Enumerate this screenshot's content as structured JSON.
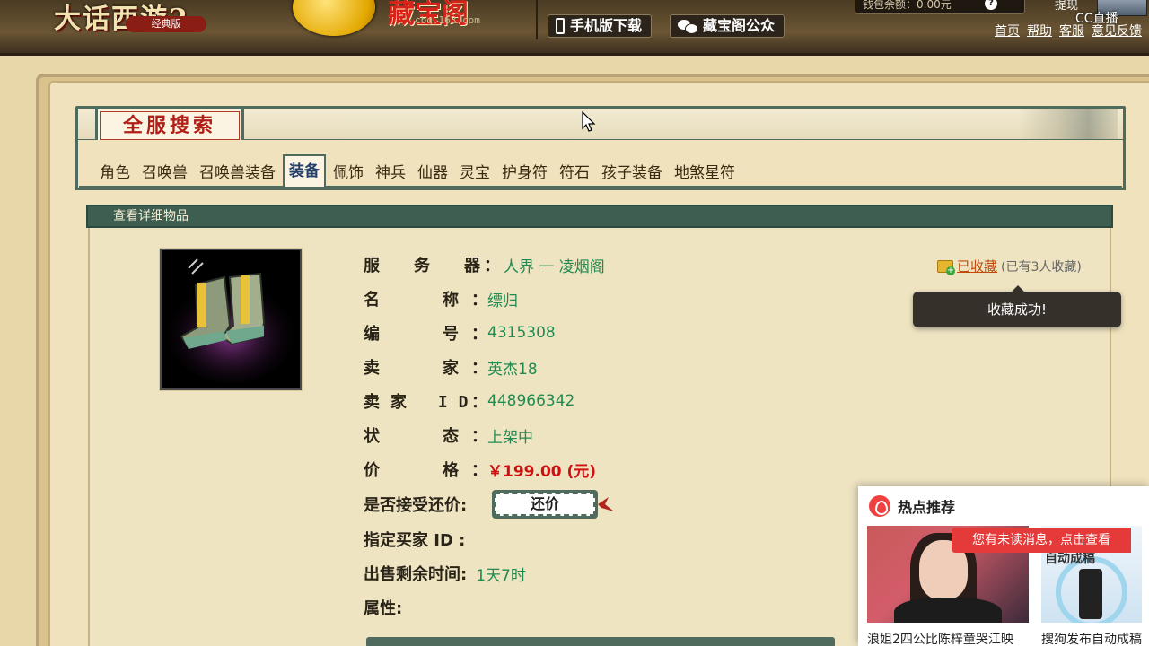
{
  "header": {
    "game_logo": "大话西游2",
    "edition": "经典版",
    "site_name": "藏宝阁",
    "domain": "cbg.163.com",
    "mobile_download": "手机版下载",
    "official_account": "藏宝阁公众",
    "balance": "钱包余额：0.00元",
    "withdraw": "提现",
    "links": [
      "首页",
      "帮助",
      "客服",
      "意见反馈"
    ],
    "watermark": "CC直播"
  },
  "search": {
    "title": "全服搜索",
    "tabs": [
      "角色",
      "召唤兽",
      "召唤兽装备",
      "装备",
      "佩饰",
      "神兵",
      "仙器",
      "灵宝",
      "护身符",
      "符石",
      "孩子装备",
      "地煞星符"
    ],
    "active_tab": "装备"
  },
  "detail": {
    "header": "查看详细物品",
    "fields": {
      "server_label": "服务器",
      "server_value": "人界 一  凌烟阁",
      "name_label": "名称",
      "name_value": "缥归",
      "id_label": "编号",
      "id_value": "4315308",
      "seller_label": "卖家",
      "seller_value": "英杰18",
      "seller_id_label": "卖家 ID",
      "seller_id_value": "448966342",
      "status_label": "状态",
      "status_value": "上架中",
      "price_label": "价格",
      "price_value": "￥199.00 (元)",
      "counter_label": "是否接受还价:",
      "counter_button": "还价",
      "buyer_label": "指定买家 ID  :",
      "time_label": "出售剩余时间:",
      "time_value": "1天7时",
      "attr_label": "属性:"
    },
    "favorite": {
      "label": "已收藏",
      "count": "(已有3人收藏)"
    },
    "toast": "收藏成功!"
  },
  "hot_panel": {
    "title": "热点推荐",
    "notice": "您有未读消息，点击查看",
    "thumb2_caption": "自动成稿",
    "captions": [
      "浪姐2四公比陈梓童哭江映",
      "搜狗发布自动成稿"
    ]
  }
}
